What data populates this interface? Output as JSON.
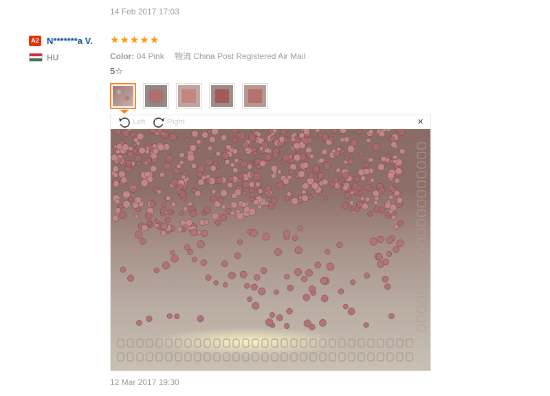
{
  "previous_review": {
    "date": "14 Feb 2017 17:03"
  },
  "review": {
    "level_badge": "A2",
    "user_name": "N*******a V.",
    "country_code": "HU",
    "rating": 5,
    "color_label": "Color:",
    "color_value": "04 Pink",
    "shipping": "物流 China Post Registered Air Mail",
    "text": "5☆",
    "thumbnails": 5,
    "viewer": {
      "rotate_left_label": "Left",
      "rotate_right_label": "Right",
      "close_label": "×"
    }
  },
  "next_review": {
    "date": "12 Mar 2017 19:30"
  },
  "colors": {
    "star": "#ff9a00",
    "username": "#0a4ea3",
    "badge": "#e62e04",
    "active_thumb": "#ff7d26"
  },
  "icons": [
    "rotate-left-icon",
    "rotate-right-icon",
    "close-icon",
    "star-icon",
    "hungary-flag-icon"
  ]
}
